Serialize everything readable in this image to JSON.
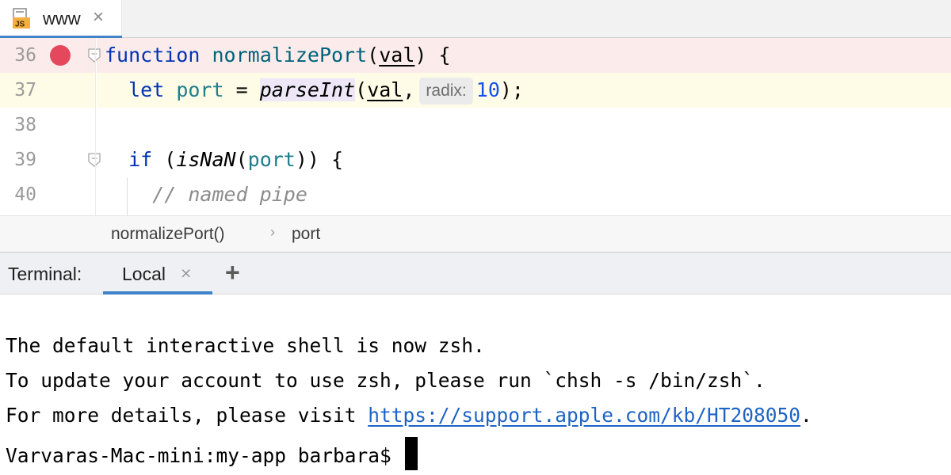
{
  "editor_tab": {
    "file_type_badge": "JS",
    "label": "www",
    "close_glyph": "×"
  },
  "colors": {
    "breakpoint_line_bg": "#fbeceb",
    "caret_line_bg": "#fefbe6",
    "breakpoint": "#e5475d",
    "accent": "#4083c9",
    "link": "#1d63c4"
  },
  "code_lines": [
    {
      "number": "36",
      "has_breakpoint": true,
      "foldable": true
    },
    {
      "number": "37",
      "current_line": true
    },
    {
      "number": "38"
    },
    {
      "number": "39",
      "foldable": true
    },
    {
      "number": "40"
    }
  ],
  "code": {
    "l36": {
      "kw": "function",
      "name": "normalizePort",
      "open": "(",
      "param": "val",
      "close": ") {"
    },
    "l37": {
      "kw": "let",
      "var": "port",
      "eq": " = ",
      "call": "parseInt",
      "open": "(",
      "arg": "val",
      "comma": ",",
      "hint": "radix:",
      "num": "10",
      "close": ");"
    },
    "l39": {
      "kw": "if",
      "open": " (",
      "call": "isNaN",
      "paren": "(",
      "arg": "port",
      "close": ")) {"
    },
    "l40": {
      "comment": "// named pipe"
    }
  },
  "breadcrumbs": {
    "items": [
      "normalizePort()",
      "port"
    ],
    "separator": "›"
  },
  "terminal": {
    "title": "Terminal:",
    "tab_label": "Local",
    "tab_close": "×",
    "add_glyph": "+",
    "lines": {
      "l1": "The default interactive shell is now zsh.",
      "l2": "To update your account to use zsh, please run `chsh -s /bin/zsh`.",
      "l3_prefix": "For more details, please visit ",
      "l3_link": "https://support.apple.com/kb/HT208050",
      "l3_suffix": ".",
      "prompt": "Varvaras-Mac-mini:my-app barbara$ "
    }
  },
  "icons": [
    "js-file-icon",
    "close-icon",
    "breakpoint-icon",
    "fold-icon",
    "chevron-right-icon",
    "plus-icon"
  ]
}
